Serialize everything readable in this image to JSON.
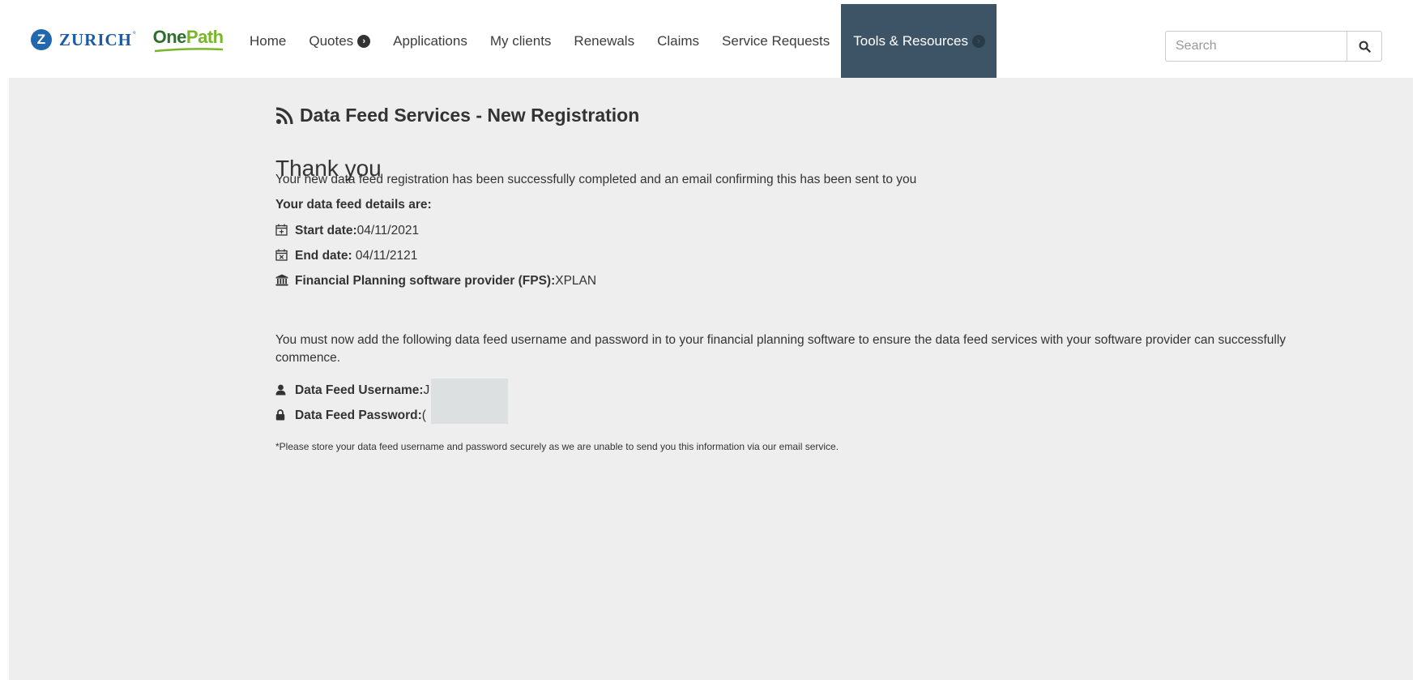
{
  "brand": {
    "zurich_letter": "Z",
    "zurich_text": "ZURICH",
    "zurich_mark": "°",
    "onepath_part1": "One",
    "onepath_part2": "Path",
    "colors": {
      "zurich_blue": "#2167ae",
      "onepath_dark": "#2f6e2f",
      "onepath_light": "#78b728"
    }
  },
  "nav": {
    "items": [
      {
        "label": "Home",
        "active": false
      },
      {
        "label": "Quotes",
        "active": false,
        "icon": "chevron-right-circle-icon"
      },
      {
        "label": "Applications",
        "active": false
      },
      {
        "label": "My clients",
        "active": false
      },
      {
        "label": "Renewals",
        "active": false
      },
      {
        "label": "Claims",
        "active": false
      },
      {
        "label": "Service Requests",
        "active": false
      },
      {
        "label": "Tools & Resources",
        "active": true,
        "icon": "chevron-right-circle-icon"
      }
    ],
    "active_color": "#3d5467"
  },
  "search": {
    "placeholder": "Search",
    "value": "",
    "icon": "search-icon"
  },
  "page": {
    "title": "Data Feed Services - New Registration",
    "title_icon": "rss-icon",
    "heading": "Thank you",
    "success_message": "Your new data feed registration has been successfully completed and an email confirming this has been sent to you",
    "details_heading": "Your data feed details are:",
    "start_date_label": "Start date:",
    "start_date_value": "04/11/2021",
    "end_date_label": "End date:",
    "end_date_value": " 04/11/2121",
    "fps_label": "Financial Planning software provider (FPS):",
    "fps_value": "XPLAN",
    "instructions": "You must now add the following data feed username and password in to your financial planning software to ensure the data feed services with your software provider can successfully commence.",
    "username_label": "Data Feed Username:",
    "username_value": "J",
    "password_label": "Data Feed Password:",
    "password_value": "(",
    "note": "*Please store your data feed username and password securely as we are unable to send you this information via our email service."
  }
}
